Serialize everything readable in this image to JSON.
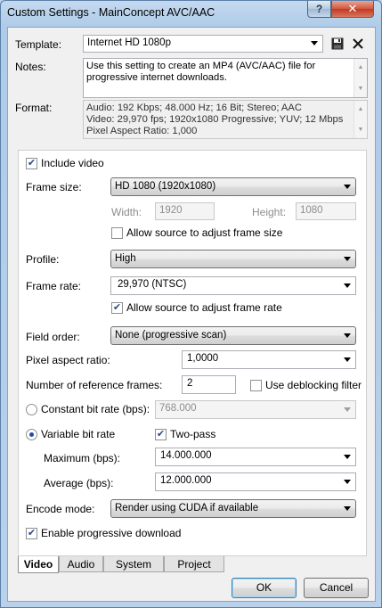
{
  "window": {
    "title": "Custom Settings - MainConcept AVC/AAC",
    "help_label": "?",
    "close_label": "✕"
  },
  "template": {
    "label": "Template:",
    "value": "Internet HD 1080p"
  },
  "notes": {
    "label": "Notes:",
    "text": "Use this setting to create an MP4 (AVC/AAC) file for progressive internet downloads."
  },
  "format": {
    "label": "Format:",
    "line1": "Audio: 192 Kbps; 48.000 Hz; 16 Bit; Stereo; AAC",
    "line2": "Video: 29,970 fps; 1920x1080 Progressive; YUV; 12 Mbps",
    "line3": "Pixel Aspect Ratio: 1,000"
  },
  "video": {
    "include_video_label": "Include video",
    "include_video_checked": true,
    "frame_size_label": "Frame size:",
    "frame_size_value": "HD 1080 (1920x1080)",
    "width_label": "Width:",
    "width_value": "1920",
    "height_label": "Height:",
    "height_value": "1080",
    "allow_frame_size_label": "Allow source to adjust frame size",
    "allow_frame_size_checked": false,
    "profile_label": "Profile:",
    "profile_value": "High",
    "frame_rate_label": "Frame rate:",
    "frame_rate_value": "29,970 (NTSC)",
    "allow_frame_rate_label": "Allow source to adjust frame rate",
    "allow_frame_rate_checked": true,
    "field_order_label": "Field order:",
    "field_order_value": "None (progressive scan)",
    "pixel_aspect_label": "Pixel aspect ratio:",
    "pixel_aspect_value": "1,0000",
    "ref_frames_label": "Number of reference frames:",
    "ref_frames_value": "2",
    "deblocking_label": "Use deblocking filter",
    "deblocking_checked": false,
    "cbr_label": "Constant bit rate (bps):",
    "cbr_selected": false,
    "cbr_value": "768.000",
    "vbr_label": "Variable bit rate",
    "vbr_selected": true,
    "two_pass_label": "Two-pass",
    "two_pass_checked": true,
    "maximum_label": "Maximum (bps):",
    "maximum_value": "14.000.000",
    "average_label": "Average (bps):",
    "average_value": "12.000.000",
    "encode_mode_label": "Encode mode:",
    "encode_mode_value": "Render using CUDA if available",
    "progressive_download_label": "Enable progressive download",
    "progressive_download_checked": true
  },
  "tabs": [
    {
      "label": "Video",
      "active": true
    },
    {
      "label": "Audio",
      "active": false
    },
    {
      "label": "System",
      "active": false
    },
    {
      "label": "Project",
      "active": false
    }
  ],
  "buttons": {
    "ok": "OK",
    "cancel": "Cancel"
  },
  "icons": {
    "save": "save-icon",
    "delete": "delete-icon",
    "check": "✔"
  }
}
